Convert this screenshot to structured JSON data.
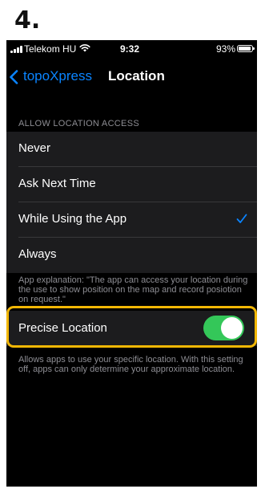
{
  "step_number": "4.",
  "status_bar": {
    "carrier": "Telekom HU",
    "time": "9:32",
    "battery_percent": "93%",
    "battery_level": 0.93,
    "icons": [
      "signal-bars-icon",
      "wifi-icon",
      "battery-icon"
    ]
  },
  "nav": {
    "back_label": "topoXpress",
    "title": "Location",
    "back_icon": "chevron-left-icon"
  },
  "location_access": {
    "section_header": "ALLOW LOCATION ACCESS",
    "options": [
      {
        "label": "Never",
        "selected": false
      },
      {
        "label": "Ask Next Time",
        "selected": false
      },
      {
        "label": "While Using the App",
        "selected": true
      },
      {
        "label": "Always",
        "selected": false
      }
    ],
    "explanation": "App explanation: \"The app can access your location during the use to show position on the map and record posiotion on request.\""
  },
  "precise_location": {
    "label": "Precise Location",
    "enabled": true,
    "footer": "Allows apps to use your specific location. With this setting off, apps can only determine your approximate location."
  },
  "colors": {
    "accent_blue": "#0a84ff",
    "toggle_green": "#34c759",
    "highlight_yellow": "#f2b705",
    "cell_background": "#1c1c1e",
    "secondary_text": "#8d8d93"
  }
}
